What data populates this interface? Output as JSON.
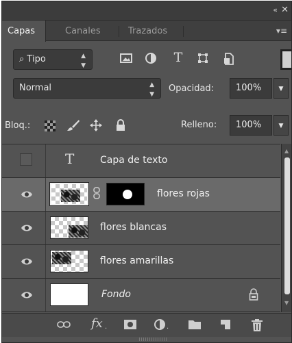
{
  "panel": {
    "title_controls": {
      "collapse": "«",
      "close": "✕"
    },
    "tabs": [
      {
        "label": "Capas",
        "active": true
      },
      {
        "label": "Canales",
        "active": false
      },
      {
        "label": "Trazados",
        "active": false
      }
    ],
    "panel_menu": "▾≡"
  },
  "filter": {
    "kind_label": "Tipo",
    "search_glyph": "⌕",
    "icons": [
      "image-filter-icon",
      "adjustment-filter-icon",
      "type-filter-icon",
      "shape-filter-icon",
      "smart-object-filter-icon"
    ]
  },
  "blend": {
    "mode": "Normal",
    "opacity_label": "Opacidad:",
    "opacity_value": "100%"
  },
  "lock": {
    "label": "Bloq.:",
    "fill_label": "Relleno:",
    "fill_value": "100%"
  },
  "layers": [
    {
      "name": "Capa de texto",
      "type": "text",
      "visible": false
    },
    {
      "name": "flores rojas",
      "type": "masked",
      "visible": true,
      "selected": true
    },
    {
      "name": "flores blancas",
      "type": "pixel",
      "visible": true
    },
    {
      "name": "flores amarillas",
      "type": "pixel",
      "visible": true
    },
    {
      "name": "Fondo",
      "type": "background",
      "visible": true,
      "locked": true
    }
  ],
  "bottom_toolbar": [
    "link-layers-icon",
    "fx-icon",
    "add-mask-icon",
    "adjustment-layer-icon",
    "new-group-icon",
    "new-layer-icon",
    "delete-icon"
  ],
  "bottom_fx": "fx",
  "colors": {
    "panel_bg": "#535353",
    "selected_row": "#6a6a6a",
    "field_bg": "#3b3b3b"
  }
}
